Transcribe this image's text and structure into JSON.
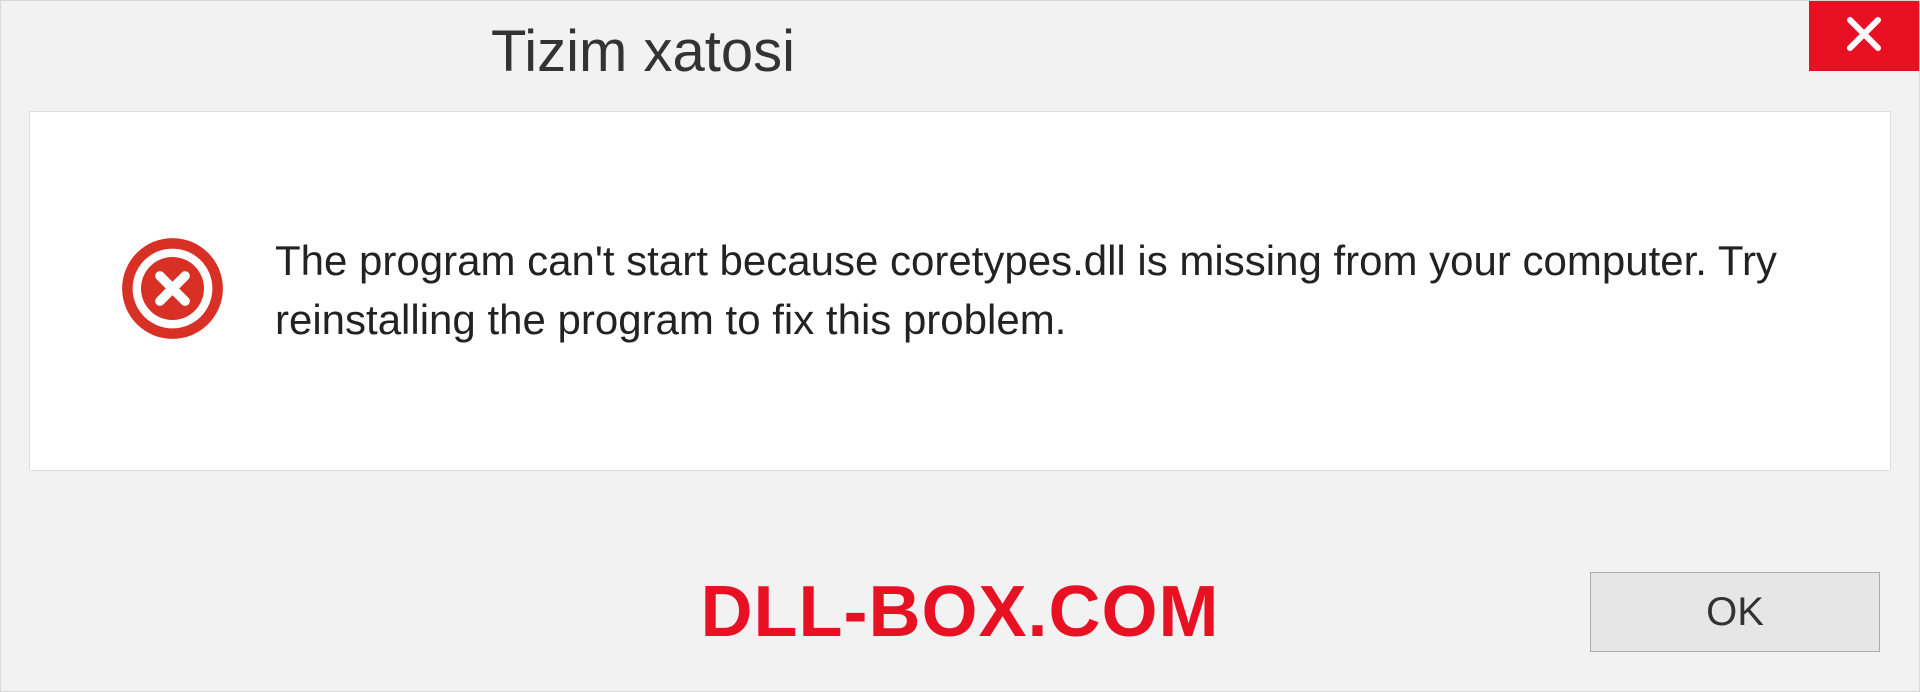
{
  "title": "Tizim xatosi",
  "message": "The program can't start because coretypes.dll is missing from your computer. Try reinstalling the program to fix this problem.",
  "watermark": "DLL-BOX.COM",
  "buttons": {
    "ok": "OK"
  },
  "colors": {
    "close_bg": "#e81123",
    "error_icon": "#d93025",
    "watermark": "#e81123"
  }
}
